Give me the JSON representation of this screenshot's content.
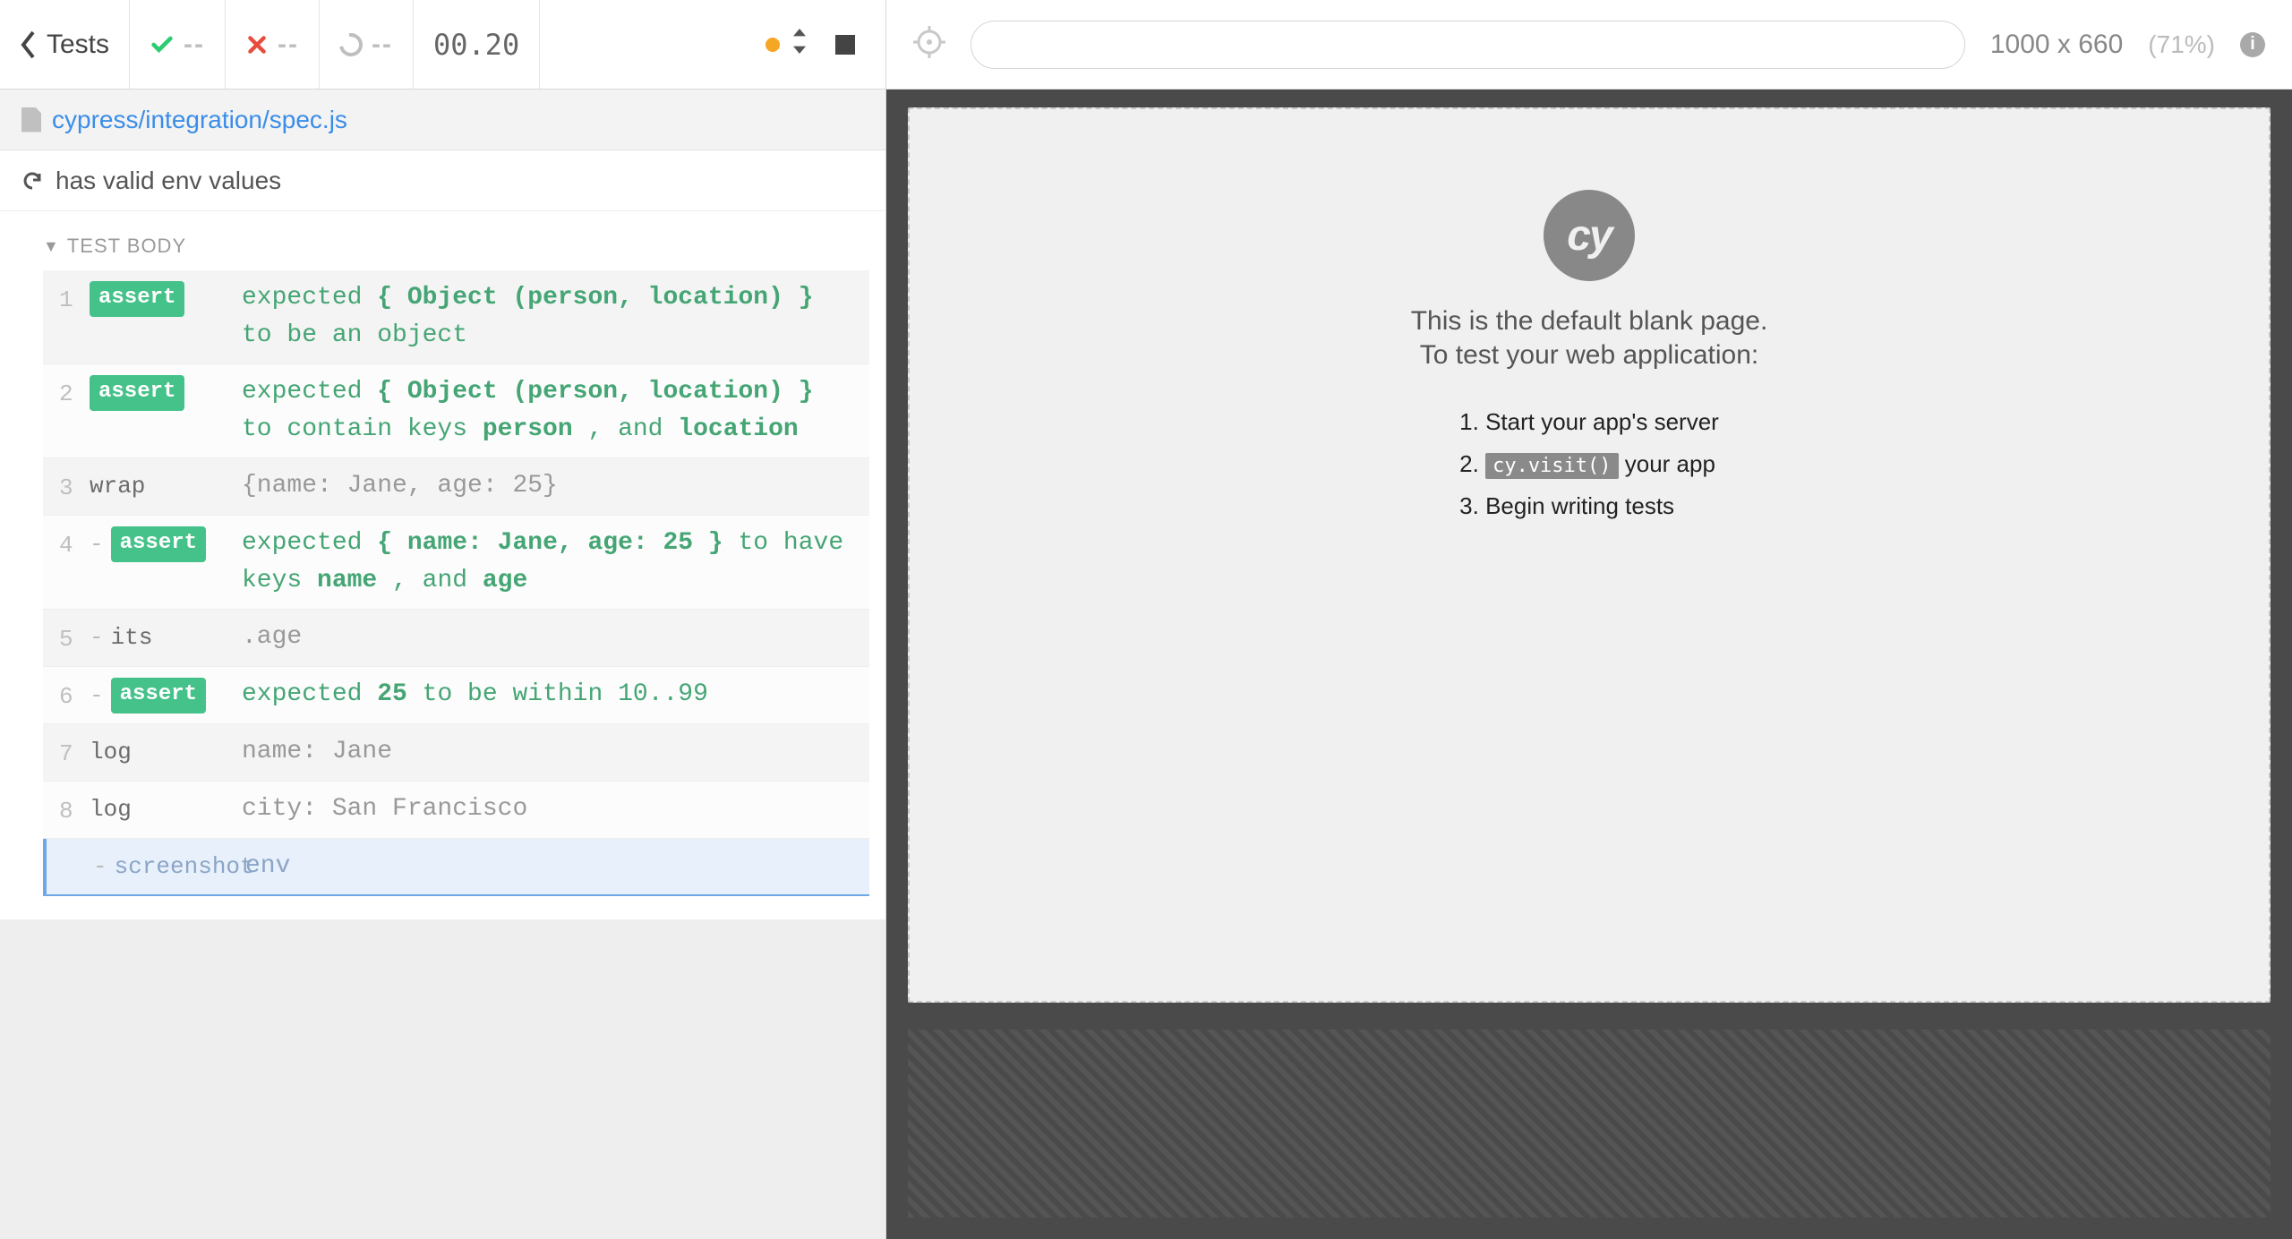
{
  "toolbar": {
    "back_label": "Tests",
    "passed_count": "--",
    "failed_count": "--",
    "pending_count": "--",
    "timer": "00.20"
  },
  "spec": {
    "path": "cypress/integration/spec.js",
    "test_title": "has valid env values",
    "section_label": "TEST BODY"
  },
  "commands": [
    {
      "num": "1",
      "name": "assert",
      "badge": true,
      "child": false,
      "segments": [
        {
          "t": "expected ",
          "c": "kw"
        },
        {
          "t": "{ Object (person, location) }",
          "c": "obj"
        },
        {
          "t": " to be an object",
          "c": "kw"
        }
      ]
    },
    {
      "num": "2",
      "name": "assert",
      "badge": true,
      "child": false,
      "segments": [
        {
          "t": "expected ",
          "c": "kw"
        },
        {
          "t": "{ Object (person, location) }",
          "c": "obj"
        },
        {
          "t": " to contain keys ",
          "c": "kw"
        },
        {
          "t": "person",
          "c": "obj"
        },
        {
          "t": " , and ",
          "c": "kw"
        },
        {
          "t": "location",
          "c": "obj"
        }
      ]
    },
    {
      "num": "3",
      "name": "wrap",
      "badge": false,
      "child": false,
      "segments": [
        {
          "t": "{name: Jane, age: 25}",
          "c": "plain"
        }
      ]
    },
    {
      "num": "4",
      "name": "assert",
      "badge": true,
      "child": true,
      "segments": [
        {
          "t": "expected ",
          "c": "kw"
        },
        {
          "t": "{ name: Jane, age: 25 }",
          "c": "obj"
        },
        {
          "t": " to have keys ",
          "c": "kw"
        },
        {
          "t": "name",
          "c": "obj"
        },
        {
          "t": " , and ",
          "c": "kw"
        },
        {
          "t": "age",
          "c": "obj"
        }
      ]
    },
    {
      "num": "5",
      "name": "its",
      "badge": false,
      "child": true,
      "segments": [
        {
          "t": ".age",
          "c": "plain"
        }
      ]
    },
    {
      "num": "6",
      "name": "assert",
      "badge": true,
      "child": true,
      "segments": [
        {
          "t": "expected ",
          "c": "kw"
        },
        {
          "t": "25",
          "c": "obj"
        },
        {
          "t": " to be within 10..99",
          "c": "kw"
        }
      ]
    },
    {
      "num": "7",
      "name": "log",
      "badge": false,
      "child": false,
      "segments": [
        {
          "t": "name: Jane",
          "c": "plain"
        }
      ]
    },
    {
      "num": "8",
      "name": "log",
      "badge": false,
      "child": false,
      "segments": [
        {
          "t": "city: San Francisco",
          "c": "plain"
        }
      ]
    }
  ],
  "running_command": {
    "name": "screenshot",
    "msg": "env"
  },
  "preview": {
    "dimensions": "1000 x 660",
    "scale_pct": "(71%)",
    "blank_line1": "This is the default blank page.",
    "blank_line2": "To test your web application:",
    "steps_prefix": [
      "Start your app's server",
      "",
      "Begin writing tests"
    ],
    "visit_code": "cy.visit()",
    "visit_suffix": " your app",
    "logo_text": "cy"
  }
}
